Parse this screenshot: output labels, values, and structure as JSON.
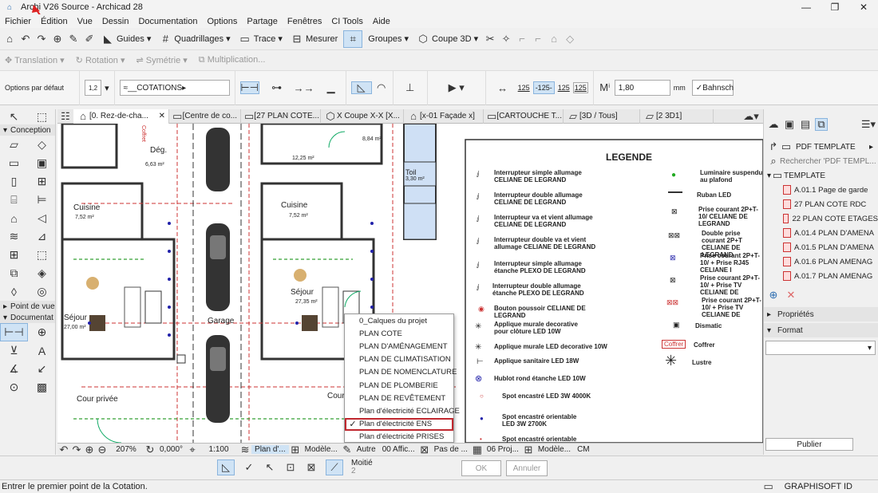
{
  "window": {
    "title": "Archi V26 Source - Archicad 28",
    "minimize": "—",
    "maximize": "❐",
    "close": "✕"
  },
  "menu": [
    "Fichier",
    "Édition",
    "Vue",
    "Dessin",
    "Documentation",
    "Options",
    "Partage",
    "Fenêtres",
    "CI Tools",
    "Aide"
  ],
  "toolbar": {
    "guides": "Guides",
    "quadrillages": "Quadrillages",
    "trace": "Trace",
    "mesurer": "Mesurer",
    "groupes": "Groupes",
    "coupe3d": "Coupe 3D"
  },
  "toolbar2": {
    "translation": "Translation",
    "rotation": "Rotation",
    "symetrie": "Symétrie",
    "multiplication": "Multiplication..."
  },
  "infobox": {
    "options": "Options par défaut",
    "layer": "__COTATIONS",
    "value_field": "1,80",
    "unit": "mm",
    "bahnsch": "Bahnsch",
    "dim_a": "125",
    "dim_b": "-125-",
    "dim_c": "125",
    "dim_d": "125",
    "dim_e": "1,2"
  },
  "toolbox": {
    "conception": "Conception",
    "point_de_vue": "Point de vue",
    "documentation": "Documentat"
  },
  "tabs": [
    "[0. Rez-de-cha...",
    "[Centre de co...",
    "[27 PLAN COTE...",
    "X Coupe X-X [X...",
    "[x-01 Façade x]",
    "[CARTOUCHE T...",
    "[3D / Tous]",
    "[2 3D1]"
  ],
  "plan": {
    "cuisine": "Cuisine",
    "cuisine_area": "7,52 m²",
    "sejour": "Séjour",
    "sejour_area": "27,35 m²",
    "sejour_area2": "27,00 m²",
    "deg": "Dég.",
    "deg_area": "6,63 m²",
    "deg_area2": "8,84 m²",
    "area_12": "12,25 m²",
    "toil": "Toil",
    "toil_area": "3,30 m²",
    "garage": "Garage",
    "cour_privee": "Cour privée",
    "cour": "Cour",
    "coffret": "Coffret"
  },
  "legend": {
    "title": "LEGENDE",
    "left": [
      "Interrupteur simple allumage CELIANE DE LEGRAND",
      "Interrupteur double allumage CELIANE DE LEGRAND",
      "Interrupteur va et vient allumage CELIANE DE LEGRAND",
      "Interrupteur double va et vient allumage CELIANE DE LEGRAND",
      "Interrupteur simple allumage étanche PLEXO DE LEGRAND",
      "Interrupteur double allumage étanche PLEXO DE LEGRAND",
      "Bouton poussoir CELIANE DE LEGRAND",
      "Applique murale decorative pour clôture LED 10W",
      "Applique murale LED decorative 10W",
      "Applique sanitaire LED 18W",
      "Hublot rond étanche LED 10W",
      "Spot encastré LED 3W 4000K",
      "Spot encastré orientable LED 3W 2700K",
      "Spot encastré orientable"
    ],
    "right": [
      "Luminaire suspendu au plafond",
      "Ruban LED",
      "Prise courant 2P+T- 10/ CELIANE DE LEGRAND",
      "Double prise courant 2P+T CELIANE DE LEGRAND",
      "Prise courant 2P+T- 10/ + Prise RJ45 CELIANE I",
      "Prise courant 2P+T- 10/ + Prise TV CELIANE DE",
      "Prise courant 2P+T- 10/ + Prise TV CELIANE DE",
      "Dismatic",
      "Coffrer",
      "Lustre"
    ],
    "coffrer_tag": "Coffrer"
  },
  "popup": {
    "items": [
      "0_Calques du projet",
      "PLAN COTE",
      "PLAN D'AMÉNAGEMENT",
      "PLAN DE CLIMATISATION",
      "PLAN DE NOMENCLATURE",
      "PLAN DE PLOMBERIE",
      "PLAN DE REVÊTEMENT",
      "Plan d'électricité ECLAIRAGE",
      "Plan d'électricité ENS",
      "Plan d'électricité PRISES"
    ],
    "checked_index": 8
  },
  "rightpanel": {
    "pdf_template": "PDF TEMPLATE",
    "search_placeholder": "Rechercher 'PDF TEMPL...",
    "template": "TEMPLATE",
    "items": [
      "A.01.1 Page de garde",
      "27 PLAN COTE RDC",
      "22 PLAN COTE ETAGES",
      "A.01.4 PLAN D'AMENA",
      "A.01.5 PLAN D'AMENA",
      "A.01.6 PLAN AMENAG",
      "A.01.7 PLAN AMENAG"
    ],
    "proprietes": "Propriétés",
    "format": "Format",
    "publier": "Publier"
  },
  "statusbar": {
    "zoom": "207%",
    "angle": "0,000°",
    "scale": "1:100",
    "plan": "Plan d'...",
    "modele": "Modèle...",
    "autre": "Autre",
    "affic": "00 Affic...",
    "pasde": "Pas de ...",
    "proj": "06 Proj...",
    "modele2": "Modèle...",
    "unit": "CM"
  },
  "pettools": {
    "moitie": "Moitié",
    "moitie_num": "2",
    "ok": "OK",
    "annuler": "Annuler"
  },
  "bottom": {
    "message": "Entrer le premier point de la Cotation.",
    "brand": "GRAPHISOFT ID"
  },
  "colors": {
    "accent": "#c0282f",
    "selection": "#cfe3f5",
    "room_blue": "#cfe0f5"
  }
}
